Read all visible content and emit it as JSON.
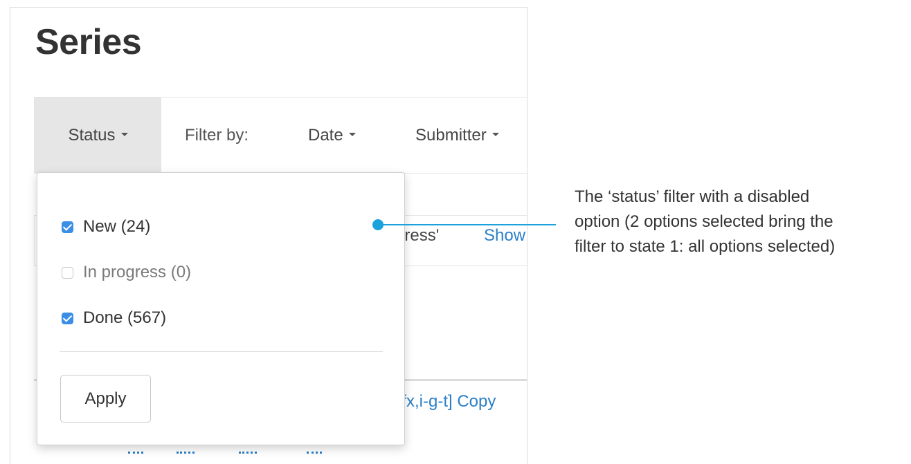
{
  "page": {
    "title": "Series"
  },
  "filter_bar": {
    "status_label": "Status",
    "filter_by_label": "Filter by:",
    "date_label": "Date",
    "submitter_label": "Submitter"
  },
  "background": {
    "progress_fragment": "gress'",
    "show_fragment": "Show",
    "copy_fragment": "gfx,i-g-t] Copy"
  },
  "status_dropdown": {
    "options": [
      {
        "label": "New (24)",
        "checked": true,
        "disabled": false
      },
      {
        "label": "In progress (0)",
        "checked": false,
        "disabled": true
      },
      {
        "label": "Done (567)",
        "checked": true,
        "disabled": false
      }
    ],
    "apply_label": "Apply"
  },
  "annotation": {
    "lines": [
      "The ‘status’ filter with a disabled",
      "option (2 options selected bring the",
      "filter to state 1: all options selected)"
    ]
  },
  "colors": {
    "accent": "#1ba1dc",
    "checkbox": "#3a8ee6",
    "link": "#2a7fc9",
    "active_tab": "#e6e6e6"
  }
}
